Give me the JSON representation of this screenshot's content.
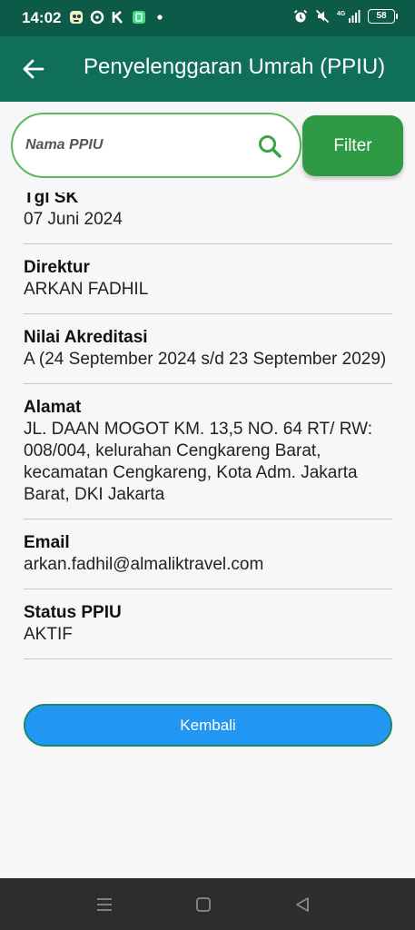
{
  "status_bar": {
    "time": "14:02",
    "left_icons": [
      "app-icon-1",
      "app-icon-2",
      "app-icon-3",
      "app-icon-4",
      "dot-icon"
    ],
    "right_icons": [
      "alarm-icon",
      "mute-icon",
      "signal-icon"
    ],
    "network": "4G",
    "battery": "58"
  },
  "app_bar": {
    "title": "Penyelenggaran Umrah (PPIU)",
    "back_icon": "arrow-left-icon",
    "color": "#0f6f5a"
  },
  "search": {
    "placeholder": "Nama PPIU",
    "value": "",
    "icon": "search-icon",
    "filter_label": "Filter"
  },
  "details": [
    {
      "label": "Tgl SK",
      "value": "07 Juni 2024"
    },
    {
      "label": "Direktur",
      "value": "ARKAN FADHIL"
    },
    {
      "label": "Nilai Akreditasi",
      "value": "A (24 September 2024 s/d 23 September 2029)"
    },
    {
      "label": "Alamat",
      "value": "JL. DAAN MOGOT KM. 13,5 NO. 64 RT/ RW: 008/004, kelurahan Cengkareng Barat, kecamatan Cengkareng, Kota Adm. Jakarta Barat, DKI Jakarta"
    },
    {
      "label": "Email",
      "value": "arkan.fadhil@almaliktravel.com"
    },
    {
      "label": "Status PPIU",
      "value": "AKTIF"
    }
  ],
  "kembali_label": "Kembali",
  "colors": {
    "status_bar": "#0e5a49",
    "app_bar": "#0f6f5a",
    "filter_button": "#2e9a45",
    "search_border": "#5cb85c",
    "kembali_button": "#2196f3"
  },
  "nav_bar": {
    "icons": [
      "menu-icon",
      "home-icon",
      "back-icon"
    ]
  }
}
